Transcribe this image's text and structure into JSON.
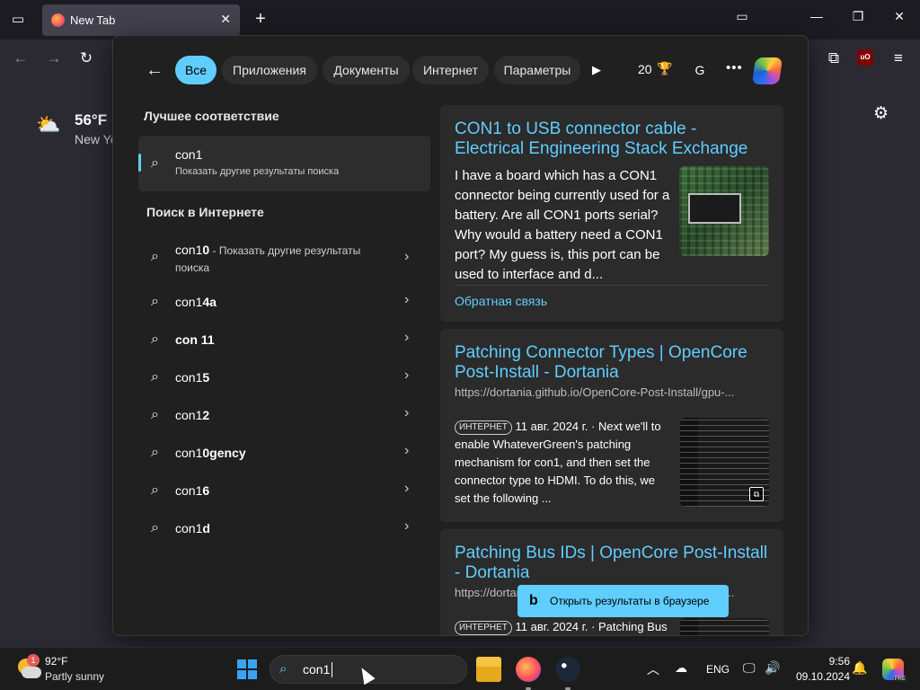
{
  "browser": {
    "tab_title": "New Tab",
    "weather_temp": "56°F",
    "weather_city": "New York"
  },
  "search_panel": {
    "filters": [
      "Все",
      "Приложения",
      "Документы",
      "Интернет",
      "Параметры"
    ],
    "points": "20",
    "avatar_letter": "G",
    "best_match_heading": "Лучшее соответствие",
    "best_match": {
      "query": "con1",
      "subtitle": "Показать другие результаты поиска"
    },
    "web_heading": "Поиск в Интернете",
    "web_suggestions": [
      {
        "prefix": "con1",
        "bold": "0",
        "suffix": " - Показать другие результаты",
        "line2": "поиска"
      },
      {
        "prefix": "con1",
        "bold": "4a",
        "suffix": "",
        "line2": ""
      },
      {
        "prefix": "con",
        "bold": "con 11",
        "suffix": "",
        "line2": ""
      },
      {
        "prefix": "con1",
        "bold": "5",
        "suffix": "",
        "line2": ""
      },
      {
        "prefix": "con1",
        "bold": "2",
        "suffix": "",
        "line2": ""
      },
      {
        "prefix": "con1",
        "bold": "0gency",
        "suffix": "",
        "line2": ""
      },
      {
        "prefix": "con1",
        "bold": "6",
        "suffix": "",
        "line2": ""
      },
      {
        "prefix": "con1",
        "bold": "d",
        "suffix": "",
        "line2": ""
      }
    ],
    "results": [
      {
        "title": "CON1 to USB connector cable - Electrical Engineering Stack Exchange",
        "snippet": "I have a board which has a CON1 connector being currently used for a battery. Are all CON1 ports serial? Why would a battery need a CON1 port? My guess is, this port can be used to interface and d...",
        "feedback": "Обратная связь"
      },
      {
        "title": "Patching Connector Types | OpenCore Post-Install - Dortania",
        "url": "https://dortania.github.io/OpenCore-Post-Install/gpu-...",
        "badge": "ИНТЕРНЕТ",
        "date": "11 авг. 2024 г.",
        "snippet": " · Next we'll to enable WhateverGreen's patching mechanism for con1, and then set the connector type to HDMI. To do this, we set the following ..."
      },
      {
        "title": "Patching Bus IDs | OpenCore Post-Install - Dortania",
        "url": "https://dortania.github.io/OpenCore-Post-Install/gpu-...",
        "badge": "ИНТЕРНЕТ",
        "date": "11 авг. 2024 г.",
        "snippet": " · Patching Bus"
      }
    ],
    "open_in_browser": "Открыть результаты в браузере"
  },
  "taskbar": {
    "weather_badge": "1",
    "temp": "92°F",
    "condition": "Partly sunny",
    "search_value": "con1",
    "language": "ENG",
    "time": "9:56",
    "date": "09.10.2024",
    "copilot_badge": "PRE"
  },
  "colors": {
    "accent": "#60cdff",
    "panel_bg": "#202020",
    "card_bg": "#2b2b2b"
  }
}
